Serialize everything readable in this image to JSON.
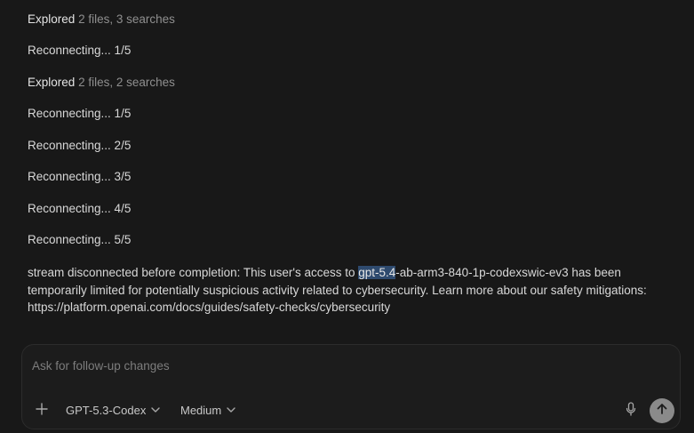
{
  "log": [
    {
      "bold": "Explored",
      "detail": "2 files, 3 searches"
    },
    {
      "text": "Reconnecting... 1/5"
    },
    {
      "bold": "Explored",
      "detail": "2 files, 2 searches"
    },
    {
      "text": "Reconnecting... 1/5"
    },
    {
      "text": "Reconnecting... 2/5"
    },
    {
      "text": "Reconnecting... 3/5"
    },
    {
      "text": "Reconnecting... 4/5"
    },
    {
      "text": "Reconnecting... 5/5"
    }
  ],
  "error": {
    "before": "stream disconnected before completion: This user's access to ",
    "highlight": "gpt-5.4",
    "after": "-ab-arm3-840-1p-codexswic-ev3 has been temporarily limited for potentially suspicious activity related to cybersecurity. Learn more about our safety mitigations: https://platform.openai.com/docs/guides/safety-checks/cybersecurity"
  },
  "composer": {
    "placeholder": "Ask for follow-up changes",
    "add_icon": "plus-icon",
    "model_label": "GPT-5.3-Codex",
    "effort_label": "Medium",
    "mic_icon": "microphone-icon",
    "send_icon": "arrow-up-icon"
  }
}
